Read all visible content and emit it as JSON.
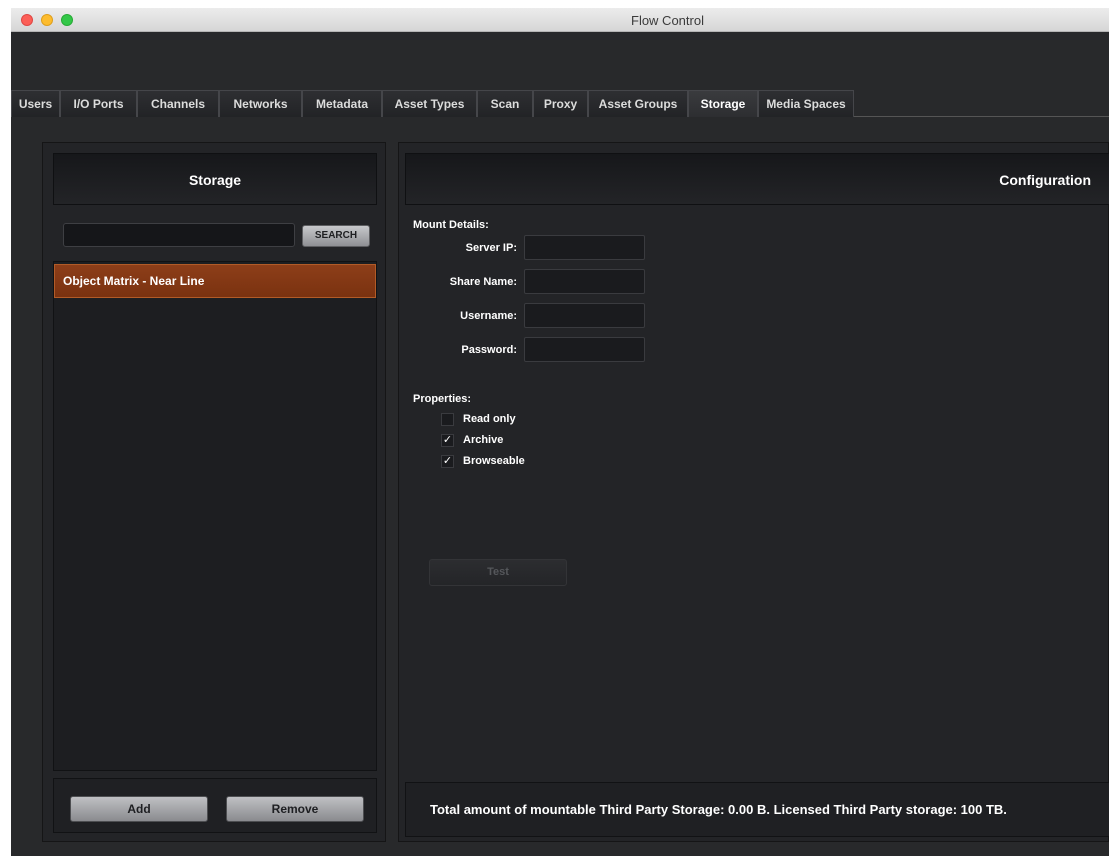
{
  "window": {
    "title": "Flow Control"
  },
  "tabs": [
    {
      "label": "Users"
    },
    {
      "label": "I/O Ports"
    },
    {
      "label": "Channels"
    },
    {
      "label": "Networks"
    },
    {
      "label": "Metadata"
    },
    {
      "label": "Asset Types"
    },
    {
      "label": "Scan"
    },
    {
      "label": "Proxy"
    },
    {
      "label": "Asset Groups"
    },
    {
      "label": "Storage",
      "active": true
    },
    {
      "label": "Media Spaces"
    }
  ],
  "storage_panel": {
    "title": "Storage",
    "search_value": "",
    "search_button": "SEARCH",
    "items": [
      {
        "label": "Object Matrix - Near Line",
        "selected": true
      }
    ],
    "add_button": "Add",
    "remove_button": "Remove"
  },
  "config_panel": {
    "title": "Configuration",
    "mount_details_label": "Mount Details:",
    "fields": {
      "server_ip": {
        "label": "Server IP:",
        "value": ""
      },
      "share_name": {
        "label": "Share Name:",
        "value": ""
      },
      "username": {
        "label": "Username:",
        "value": ""
      },
      "password": {
        "label": "Password:",
        "value": ""
      }
    },
    "properties_label": "Properties:",
    "properties": {
      "read_only": {
        "label": "Read only",
        "checked": false
      },
      "archive": {
        "label": "Archive",
        "checked": true
      },
      "browseable": {
        "label": "Browseable",
        "checked": true
      }
    },
    "test_button": "Test",
    "footer_text": "Total amount of mountable Third Party Storage: 0.00 B.  Licensed Third Party storage: 100 TB."
  },
  "colors": {
    "background": "#28292b",
    "selected_item": "#8d3e19",
    "text": "#ffffff"
  }
}
